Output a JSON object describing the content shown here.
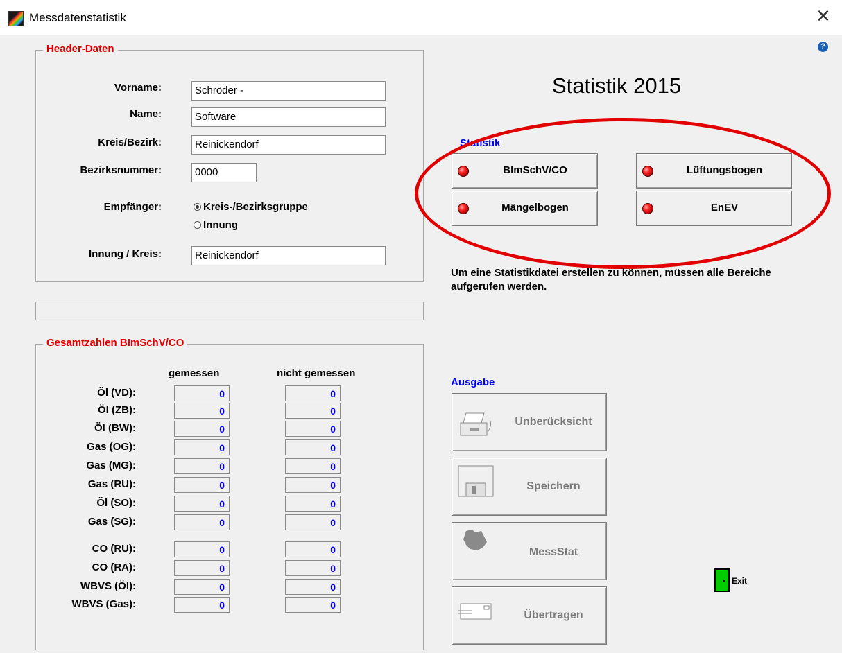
{
  "window": {
    "title": "Messdatenstatistik",
    "close": "✕"
  },
  "header_group": {
    "legend": "Header-Daten",
    "vorname_label": "Vorname:",
    "vorname_value": "Schröder -",
    "name_label": "Name:",
    "name_value": "Software",
    "kreis_label": "Kreis/Bezirk:",
    "kreis_value": "Reinickendorf",
    "bezirksnummer_label": "Bezirksnummer:",
    "bezirksnummer_value": "0000",
    "empfaenger_label": "Empfänger:",
    "radio_kreis": "Kreis-/Bezirksgruppe",
    "radio_innung": "Innung",
    "innung_label": "Innung / Kreis:",
    "innung_value": "Reinickendorf"
  },
  "totals_group": {
    "legend": "Gesamtzahlen BImSchV/CO",
    "col_gemessen": "gemessen",
    "col_nicht": "nicht gemessen",
    "rows": [
      {
        "label": "Öl (VD):",
        "a": "0",
        "b": "0"
      },
      {
        "label": "Öl (ZB):",
        "a": "0",
        "b": "0"
      },
      {
        "label": "Öl (BW):",
        "a": "0",
        "b": "0"
      },
      {
        "label": "Gas (OG):",
        "a": "0",
        "b": "0"
      },
      {
        "label": "Gas (MG):",
        "a": "0",
        "b": "0"
      },
      {
        "label": "Gas (RU):",
        "a": "0",
        "b": "0"
      },
      {
        "label": "Öl (SO):",
        "a": "0",
        "b": "0"
      },
      {
        "label": "Gas (SG):",
        "a": "0",
        "b": "0"
      },
      {
        "label": "CO (RU):",
        "a": "0",
        "b": "0"
      },
      {
        "label": "CO (RA):",
        "a": "0",
        "b": "0"
      },
      {
        "label": "WBVS (Öl):",
        "a": "0",
        "b": "0"
      },
      {
        "label": "WBVS (Gas):",
        "a": "0",
        "b": "0"
      }
    ]
  },
  "main_title": "Statistik 2015",
  "statistik": {
    "legend": "Statistik",
    "btn_bimschv": "BImSchV/CO",
    "btn_lueftung": "Lüftungsbogen",
    "btn_maengel": "Mängelbogen",
    "btn_enev": "EnEV"
  },
  "note": "Um eine Statistikdatei erstellen zu können, müssen alle Bereiche aufgerufen werden.",
  "ausgabe": {
    "legend": "Ausgabe",
    "btn_unberuecksicht": "Unberücksicht",
    "btn_speichern": "Speichern",
    "btn_messstat": "MessStat",
    "btn_uebertragen": "Übertragen"
  },
  "help": "?",
  "exit": "Exit",
  "colors": {
    "legend_red": "#e00000",
    "value_blue": "#0000ff",
    "annotation": "#e00000"
  }
}
